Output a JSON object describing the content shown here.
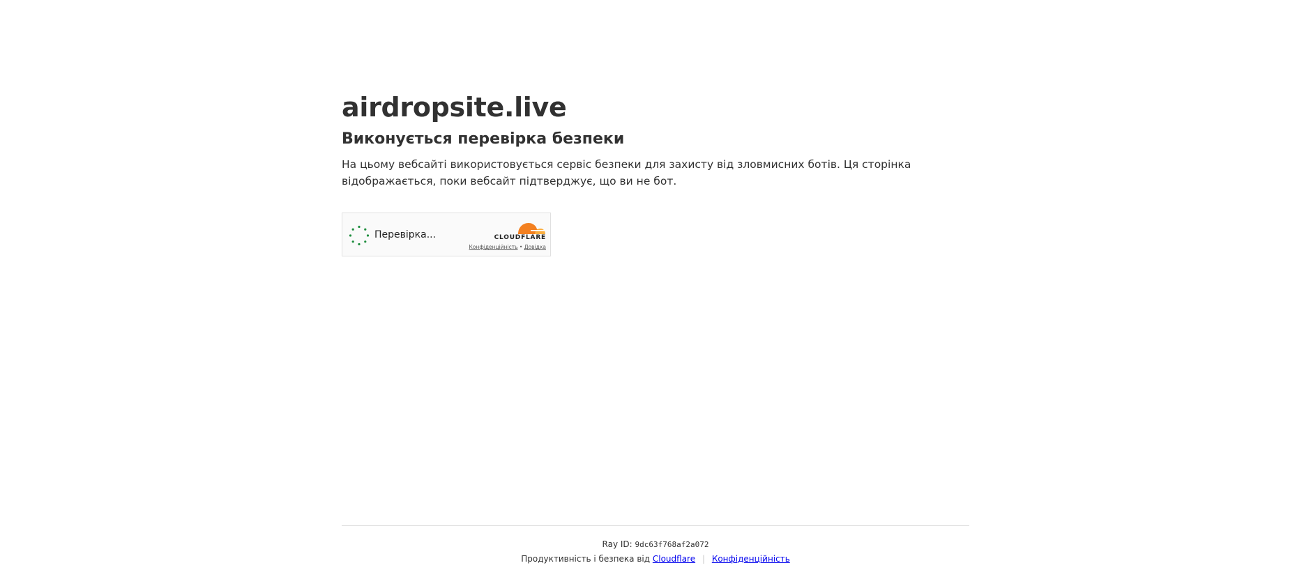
{
  "main": {
    "site_title": "airdropsite.live",
    "subtitle": "Виконується перевірка безпеки",
    "description": "На цьому вебсайті використовується сервіс безпеки для захисту від зловмисних ботів. Ця сторінка відображається, поки вебсайт підтверджує, що ви не бот."
  },
  "widget": {
    "status_text": "Перевірка...",
    "brand_wordmark": "CLOUDFLARE",
    "privacy_link": "Конфіденційність",
    "link_separator": "•",
    "help_link": "Довідка",
    "spinner_icon": "loading-dots-icon",
    "logo_icon": "cloudflare-cloud-icon",
    "colors": {
      "spinner": "#1e8e3e",
      "cloud_primary": "#f38020",
      "cloud_secondary": "#faae40"
    }
  },
  "footer": {
    "ray_label": "Ray ID:",
    "ray_id": "9dc63f768af2a072",
    "performance_text": "Продуктивність і безпека від",
    "cloudflare_link": "Cloudflare",
    "separator": "|",
    "privacy_link": "Конфіденційність"
  }
}
